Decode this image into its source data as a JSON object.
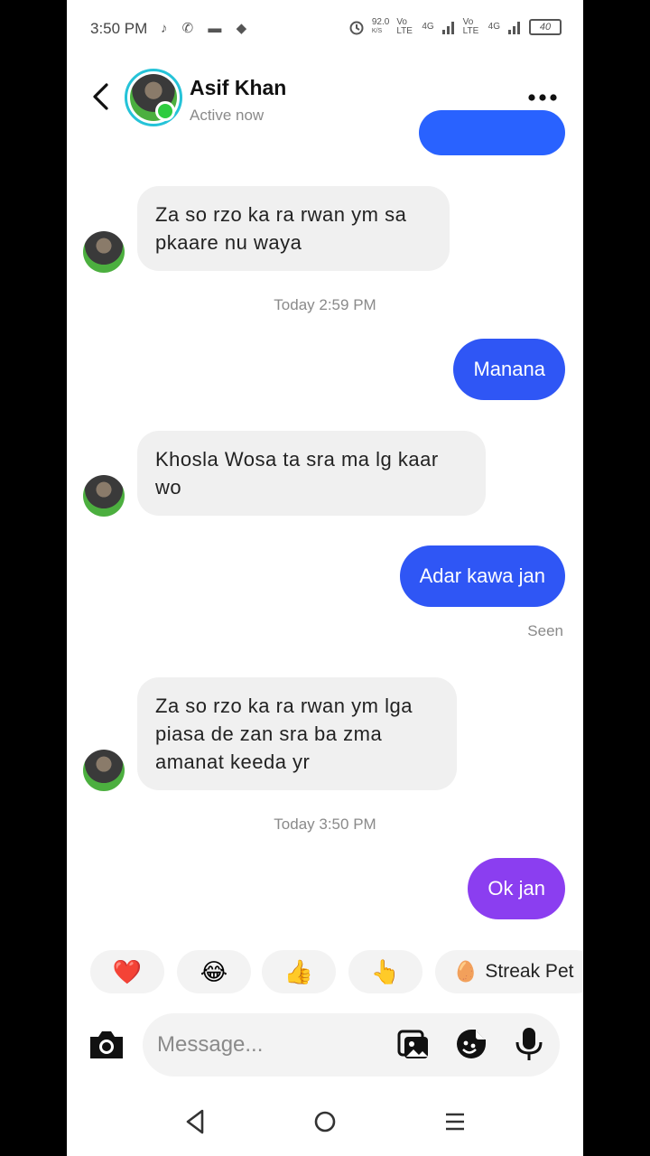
{
  "status_bar": {
    "time": "3:50 PM",
    "left_icons": "♪ ✆ ▬ ◆",
    "speed": "92.0",
    "speed_unit": "K/S",
    "net1": "Vo LTE",
    "net2": "4G",
    "net3": "Vo LTE",
    "net4": "4G",
    "battery": "40"
  },
  "header": {
    "contact_name": "Asif Khan",
    "presence": "Active now",
    "back_icon": "chevron-left-icon",
    "more_icon": "more-horizontal-icon"
  },
  "messages": [
    {
      "direction": "in",
      "text": "Za so rzo ka ra rwan ym sa pkaare nu waya"
    },
    {
      "type": "timestamp",
      "text": "Today 2:59 PM"
    },
    {
      "direction": "out",
      "text": "Manana",
      "color": "#2f56f5"
    },
    {
      "direction": "in",
      "text": "Khosla Wosa ta sra ma lg kaar wo"
    },
    {
      "direction": "out",
      "text": "Adar kawa jan",
      "color": "#2f56f5"
    },
    {
      "type": "receipt",
      "text": "Seen"
    },
    {
      "direction": "in",
      "text": "Za so rzo ka ra rwan ym lga piasa de zan sra ba zma amanat keeda yr"
    },
    {
      "type": "timestamp",
      "text": "Today 3:50 PM"
    },
    {
      "direction": "out",
      "text": "Ok jan",
      "color": "#8b3ef0"
    }
  ],
  "reactions": [
    {
      "emoji": "❤️",
      "icon": "heart-icon"
    },
    {
      "emoji": "😂",
      "icon": "laughing-icon"
    },
    {
      "emoji": "👍",
      "icon": "thumbs-up-icon"
    },
    {
      "emoji": "👆",
      "icon": "pointing-icon"
    },
    {
      "emoji": "🥚",
      "label": "Streak Pet",
      "icon": "egg-icon"
    }
  ],
  "composer": {
    "placeholder": "Message...",
    "camera_icon": "camera-icon",
    "gallery_icon": "gallery-icon",
    "sticker_icon": "sticker-icon",
    "mic_icon": "microphone-icon"
  },
  "colors": {
    "outgoing_blue": "#2f56f5",
    "outgoing_purple": "#8b3ef0",
    "incoming_bubble": "#f0f0f0",
    "online": "#2ecc40",
    "story_ring": "#25c3d8"
  }
}
